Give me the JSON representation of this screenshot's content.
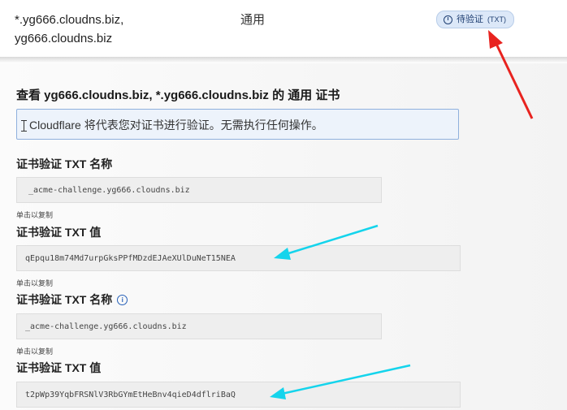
{
  "record_row": {
    "host_line1": "*.yg666.cloudns.biz,",
    "host_line2": "yg666.cloudns.biz",
    "cert_type": "通用",
    "status_label": "待验证",
    "status_suffix": "(TXT)"
  },
  "details": {
    "heading": "查看 yg666.cloudns.biz, *.yg666.cloudns.biz 的 通用 证书",
    "info_message": "Cloudflare 将代表您对证书进行验证。无需执行任何操作。",
    "copy_hint": "单击以复制",
    "records": [
      {
        "label": "证书验证 TXT 名称",
        "value": "_acme-challenge.yg666.cloudns.biz"
      },
      {
        "label": "证书验证 TXT 值",
        "value": "qEpqu18m74Md7urpGksPPfMDzdEJAeXUlDuNeT15NEA"
      },
      {
        "label": "证书验证 TXT 名称",
        "value": "_acme-challenge.yg666.cloudns.biz"
      },
      {
        "label": "证书验证 TXT 值",
        "value": "t2pWp39YqbFRSNlV3RbGYmEtHeBnv4qieD4dflriBaQ"
      }
    ]
  },
  "colors": {
    "annotation_red": "#e8231f",
    "annotation_cyan": "#14d4ec",
    "info_border": "#8fb0dd",
    "badge_bg": "#dce8f8"
  },
  "icons": [
    "clock-icon",
    "info-icon"
  ]
}
